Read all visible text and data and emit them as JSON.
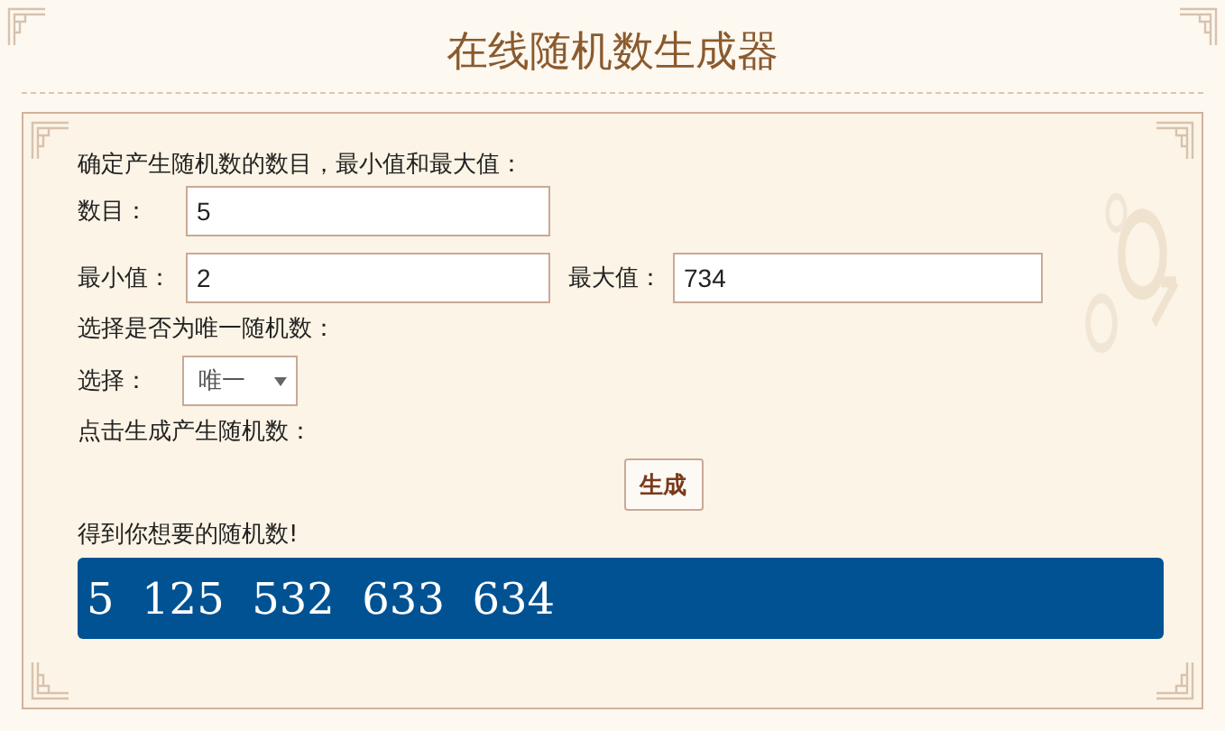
{
  "title": "在线随机数生成器",
  "intro": "确定产生随机数的数目，最小值和最大值：",
  "count": {
    "label": "数目：",
    "value": "5"
  },
  "min": {
    "label": "最小值：",
    "value": "2"
  },
  "max": {
    "label": "最大值：",
    "value": "734"
  },
  "unique_prompt": "选择是否为唯一随机数：",
  "choice": {
    "label": "选择：",
    "value": "唯一"
  },
  "generate_prompt": "点击生成产生随机数：",
  "generate_button": "生成",
  "result_label": "得到你想要的随机数!",
  "result": "5  125  532  633  634"
}
